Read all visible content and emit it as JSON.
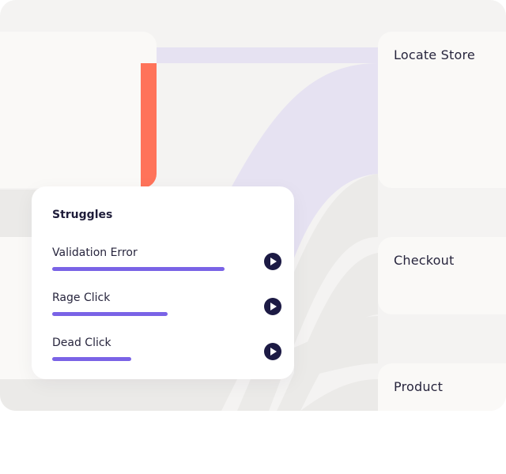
{
  "destinations": {
    "locate_store": "Locate Store",
    "checkout": "Checkout",
    "product": "Product"
  },
  "struggles": {
    "title": "Struggles",
    "items": [
      {
        "label": "Validation Error",
        "value": 1.0
      },
      {
        "label": "Rage Click",
        "value": 0.67
      },
      {
        "label": "Dead Click",
        "value": 0.46
      }
    ]
  },
  "colors": {
    "accent_bar": "#7a63e6",
    "source_highlight": "#ff735a",
    "flow_highlight": "#e6e2f2",
    "play_button": "#1c1a44"
  }
}
